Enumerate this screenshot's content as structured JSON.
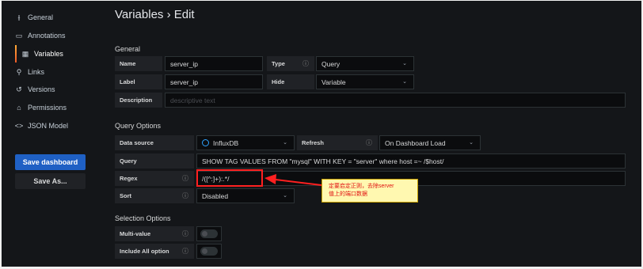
{
  "sidebar": {
    "items": [
      {
        "name": "sidebar-item-general",
        "icon": "sliders-icon",
        "glyph": "⫲",
        "label": "General"
      },
      {
        "name": "sidebar-item-annotations",
        "icon": "comment-icon",
        "glyph": "▭",
        "label": "Annotations"
      },
      {
        "name": "sidebar-item-variables",
        "icon": "calculator-icon",
        "glyph": "▦",
        "label": "Variables"
      },
      {
        "name": "sidebar-item-links",
        "icon": "link-icon",
        "glyph": "⚲",
        "label": "Links"
      },
      {
        "name": "sidebar-item-versions",
        "icon": "history-icon",
        "glyph": "↺",
        "label": "Versions"
      },
      {
        "name": "sidebar-item-permissions",
        "icon": "lock-icon",
        "glyph": "⌂",
        "label": "Permissions"
      },
      {
        "name": "sidebar-item-json-model",
        "icon": "code-icon",
        "glyph": "<>",
        "label": "JSON Model"
      }
    ],
    "save_dashboard": "Save dashboard",
    "save_as": "Save As..."
  },
  "page": {
    "title": "Variables › Edit"
  },
  "general": {
    "heading": "General",
    "name_label": "Name",
    "name_value": "server_ip",
    "type_label": "Type",
    "type_value": "Query",
    "label_label": "Label",
    "label_value": "server_ip",
    "hide_label": "Hide",
    "hide_value": "Variable",
    "description_label": "Description",
    "description_placeholder": "descriptive text"
  },
  "query_options": {
    "heading": "Query Options",
    "datasource_label": "Data source",
    "datasource_value": "InfluxDB",
    "refresh_label": "Refresh",
    "refresh_value": "On Dashboard Load",
    "query_label": "Query",
    "query_value": "SHOW TAG VALUES FROM \"mysql\" WITH KEY = \"server\"   where host =~ /$host/",
    "regex_label": "Regex",
    "regex_value": "/([^:]+):.*/",
    "sort_label": "Sort",
    "sort_value": "Disabled"
  },
  "selection_options": {
    "heading": "Selection Options",
    "multi_value_label": "Multi-value",
    "include_all_label": "Include All option"
  },
  "annotation": {
    "note": "定要启定正则，去除server\n值上的端口数据",
    "color": "#ff2020"
  },
  "colors": {
    "accent": "#1f60c4",
    "background": "#141619",
    "active_bar": "#f05a28"
  }
}
